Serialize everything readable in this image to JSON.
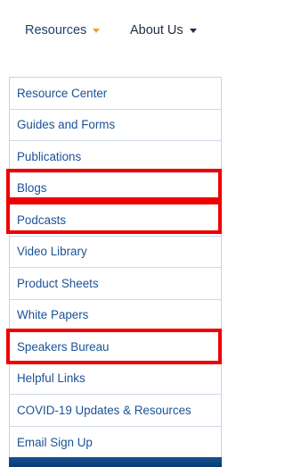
{
  "nav": {
    "resources_label": "Resources",
    "about_label": "About Us"
  },
  "menu": {
    "items": [
      "Resource Center",
      "Guides and Forms",
      "Publications",
      "Blogs",
      "Podcasts",
      "Video Library",
      "Product Sheets",
      "White Papers",
      "Speakers Bureau",
      "Helpful Links",
      "COVID-19 Updates & Resources",
      "Email Sign Up"
    ]
  },
  "highlighted_items": [
    "Blogs",
    "Podcasts",
    "Speakers Bureau"
  ],
  "colors": {
    "link": "#1b5296",
    "nav_text": "#1f3f73",
    "accent_caret": "#f5a21b",
    "highlight": "#ee0000",
    "border": "#c7d3e4"
  },
  "icons": [
    "chevron-down-icon"
  ]
}
